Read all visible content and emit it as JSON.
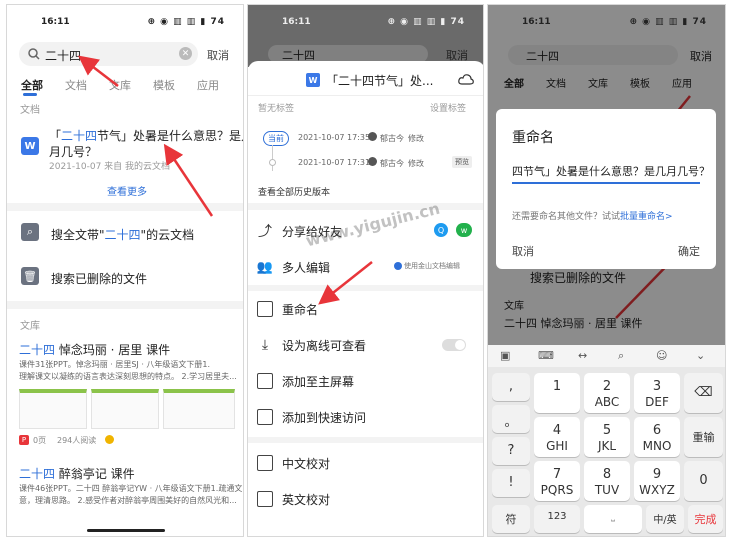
{
  "status": {
    "time": "16:11",
    "icons": "⊕ ◉ ▥ ▥ ▮ 74"
  },
  "panel1": {
    "search": {
      "value": "二十四",
      "cancel": "取消"
    },
    "tabs": [
      "全部",
      "文档",
      "文库",
      "模板",
      "应用"
    ],
    "doc_section": "文档",
    "doc": {
      "q1": "「",
      "hl": "二十四",
      "title_rest": "节气」处暑是什么意思？是几",
      "title2": "月几号？",
      "meta": "2021-10-07  来自  我的云文档"
    },
    "more": "查看更多",
    "fulltext": {
      "pre": "搜全文带\"",
      "hl": "二十四",
      "post": "\"的云文档"
    },
    "deleted": "搜索已删除的文件",
    "lib_label": "文库",
    "lib1": {
      "hl": "二十四",
      "rest": " 悼念玛丽 · 居里 课件",
      "desc1": "课件31张PPT。悼念玛丽 · 居里SJ · 八年级语文下册1.",
      "desc2": "理解课文以凝练的语言表达深刻思想的特点。 2.学习居里夫...",
      "pages": "0页",
      "reads": "294人阅读"
    },
    "lib2": {
      "hl": "二十四",
      "rest": " 醉翁亭记 课件",
      "desc1": "课件46张PPT。二十四 醉翁亭记YW · 八年级语文下册1.疏通文",
      "desc2": "意，理清思路。 2.感受作者对醉翁亭周围美好的自然风光和..."
    }
  },
  "panel2": {
    "search_value": "二十四",
    "cancel": "取消",
    "sheet_title": "「二十四节气」处...",
    "no_tag": "暂无标签",
    "set_tag": "设置标签",
    "badge": "当前",
    "v1": {
      "time": "2021-10-07 17:35",
      "user": "郁古今",
      "action": "修改"
    },
    "v2": {
      "time": "2021-10-07 17:31",
      "user": "郁古今",
      "action": "修改",
      "preview": "预览"
    },
    "all_versions": "查看全部历史版本",
    "share": "分享给好友",
    "multi": "多人编辑",
    "multi_note": "使用金山文档编辑",
    "menu": [
      "重命名",
      "设为离线可查看",
      "添加至主屏幕",
      "添加到快速访问",
      "中文校对",
      "英文校对"
    ]
  },
  "panel3": {
    "search_value": "二十四",
    "cancel": "取消",
    "dialog": {
      "title": "重命名",
      "value": "四节气」处暑是什么意思？是几月几号？",
      "hint": "还需要命名其他文件？试试",
      "hint_link": "批量重命名>",
      "cancel": "取消",
      "ok": "确定"
    },
    "bg_deleted": "搜索已删除的文件",
    "bg_lib": "文库",
    "bg_lib_item": "二十四 悼念玛丽 · 居里 课件",
    "keys": {
      "side": [
        ",",
        "。",
        "?",
        "!"
      ],
      "r1": [
        [
          "1",
          ""
        ],
        [
          "2",
          "ABC"
        ],
        [
          "3",
          "DEF"
        ]
      ],
      "r2": [
        [
          "4",
          "GHI"
        ],
        [
          "5",
          "JKL"
        ],
        [
          "6",
          "MNO"
        ]
      ],
      "r3": [
        [
          "7",
          "PQRS"
        ],
        [
          "8",
          "TUV"
        ],
        [
          "9",
          "WXYZ"
        ]
      ],
      "backspace": "⌫",
      "enter_key": "重输",
      "zero": "0",
      "sym": "符",
      "num": "123",
      "lang": "中/英",
      "done": "完成"
    }
  },
  "watermark": "www.yigujin.cn",
  "colors": {
    "accent": "#2e6fd8",
    "arrow": "#e8353a",
    "done": "#e8353a"
  }
}
